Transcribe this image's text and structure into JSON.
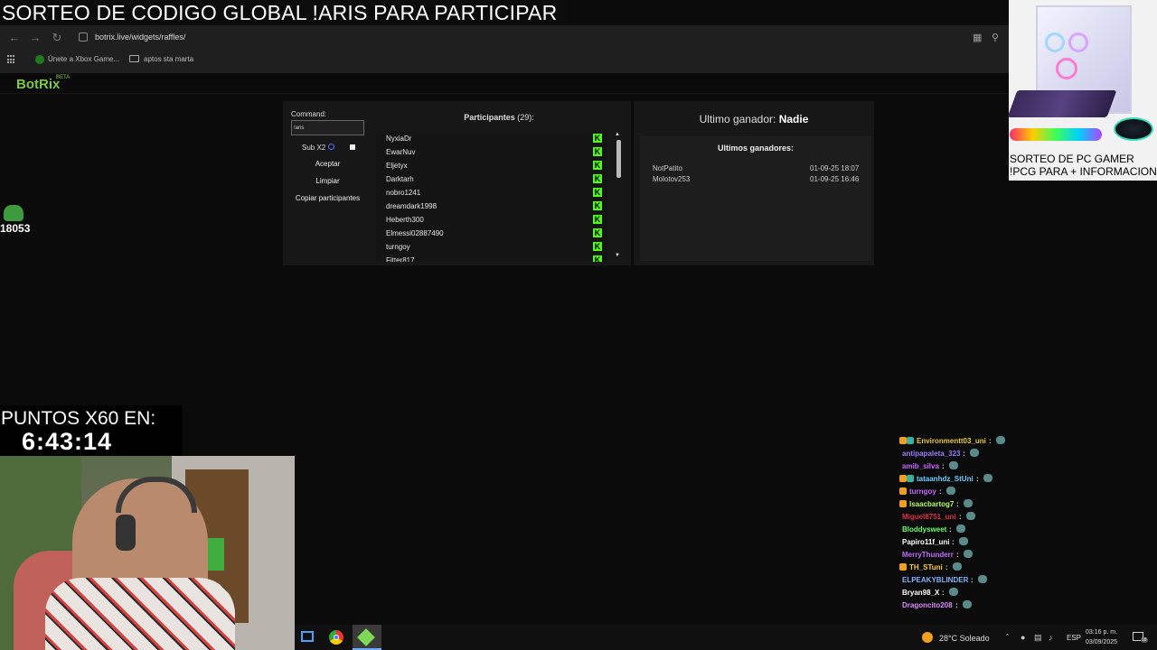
{
  "banner": {
    "text": "SORTEO DE CODIGO GLOBAL !ARIS PARA PARTICIPAR"
  },
  "browser": {
    "url": "botrix.live/widgets/raffles/",
    "bookmarks": [
      {
        "label": "Únete a Xbox Game...",
        "icon": "xbox-icon"
      },
      {
        "label": "aptos sta marta",
        "icon": "folder-icon"
      }
    ]
  },
  "app": {
    "logo": "BotRix",
    "logo_badge": "BETA"
  },
  "raffle": {
    "command_label": "Command:",
    "command_value": "!aris",
    "subx2_label": "Sub X2",
    "accept_label": "Aceptar",
    "clear_label": "Limpiar",
    "copy_label": "Copiar participantes",
    "participants_title": "Participantes",
    "participants_count": "(29):",
    "participants": [
      {
        "name": "NyxiaDr",
        "platform": "K"
      },
      {
        "name": "EwarNuv",
        "platform": "K"
      },
      {
        "name": "Eljetyx",
        "platform": "K"
      },
      {
        "name": "Darktarh",
        "platform": "K"
      },
      {
        "name": "nobro1241",
        "platform": "K"
      },
      {
        "name": "dreamdark1998",
        "platform": "K"
      },
      {
        "name": "Heberth300",
        "platform": "K"
      },
      {
        "name": "Elmessi02887490",
        "platform": "K"
      },
      {
        "name": "turngoy",
        "platform": "K"
      },
      {
        "name": "Fitter817",
        "platform": "K"
      }
    ]
  },
  "winners": {
    "last_winner_label": "Ultimo ganador:",
    "last_winner_name": "Nadie",
    "recent_title": "Ultimos ganadores:",
    "recent": [
      {
        "name": "NotPatito",
        "date": "01-09-25 18:07"
      },
      {
        "name": "Molotov253",
        "date": "01-09-25 16:46"
      }
    ]
  },
  "overlay": {
    "points_total": "18053",
    "timer_label": "PUNTOS X60 EN:",
    "timer_value": "6:43:14",
    "ad_line1": "SORTEO DE PC GAMER",
    "ad_line2": "!PCG PARA + INFORMACION"
  },
  "chat": {
    "messages": [
      {
        "user": "Environmentt03_uni",
        "color": "#e8c93a",
        "badges": 2
      },
      {
        "user": "antipapaleta_323",
        "color": "#9c7bff",
        "badges": 0
      },
      {
        "user": "amib_silva",
        "color": "#c46bff",
        "badges": 0
      },
      {
        "user": "tataanhdz_StUni",
        "color": "#6ad0ff",
        "badges": 2
      },
      {
        "user": "turngoy",
        "color": "#c46bff",
        "badges": 1
      },
      {
        "user": "Isaacbartog7",
        "color": "#b3ff5a",
        "badges": 1
      },
      {
        "user": "Miguel8751_uni",
        "color": "#e0304a",
        "badges": 0
      },
      {
        "user": "Bloddysweet",
        "color": "#6dff6d",
        "badges": 0
      },
      {
        "user": "Papiro11f_uni",
        "color": "#ffffff",
        "badges": 0
      },
      {
        "user": "MerryThunderr",
        "color": "#c46bff",
        "badges": 0
      },
      {
        "user": "TH_STuni",
        "color": "#ffcc33",
        "badges": 1
      },
      {
        "user": "ELPEAKYBLINDER",
        "color": "#7fb3ff",
        "badges": 0
      },
      {
        "user": "Bryan98_X",
        "color": "#ffffff",
        "badges": 0
      },
      {
        "user": "Dragoncito208",
        "color": "#d98cff",
        "badges": 0
      }
    ],
    "separator": ":"
  },
  "taskbar": {
    "weather": "28°C Soleado",
    "language": "ESP",
    "time": "03:16 p. m.",
    "date": "03/09/2025",
    "notification_count": "18"
  }
}
